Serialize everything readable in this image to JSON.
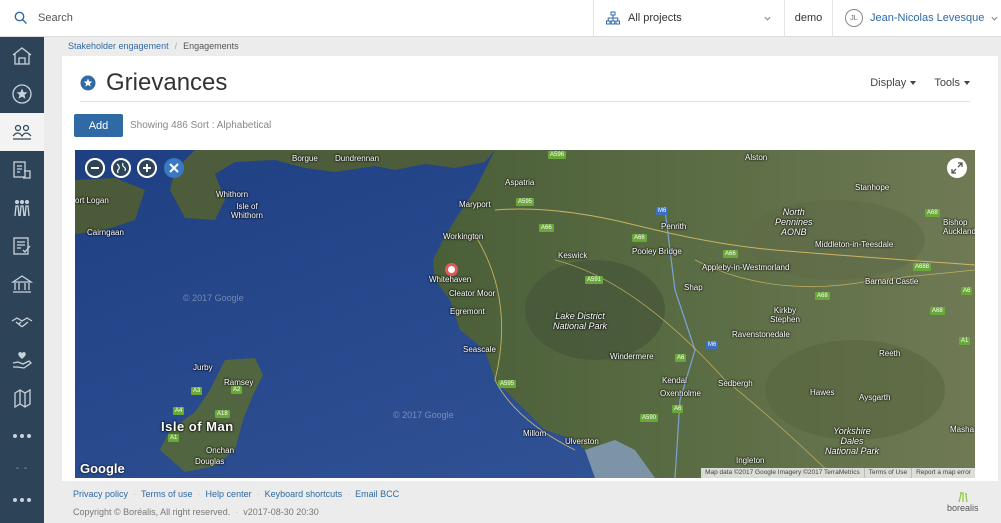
{
  "topbar": {
    "search_placeholder": "Search",
    "project_selector": "All projects",
    "workspace": "demo",
    "user_initials": "JL",
    "user_name": "Jean-Nicolas Levesque"
  },
  "sidebar": {
    "items": [
      {
        "icon": "home-icon"
      },
      {
        "icon": "star-icon"
      },
      {
        "icon": "stakeholders-icon",
        "active": true
      },
      {
        "icon": "documents-icon"
      },
      {
        "icon": "groups-icon"
      },
      {
        "icon": "checklist-icon"
      },
      {
        "icon": "institution-icon"
      },
      {
        "icon": "handshake-icon"
      },
      {
        "icon": "hand-heart-icon"
      },
      {
        "icon": "map-icon"
      },
      {
        "icon": "more-icon"
      }
    ],
    "bottom_more": "more-icon"
  },
  "breadcrumb": {
    "parent": "Stakeholder engagement",
    "current": "Engagements"
  },
  "page": {
    "title": "Grievances",
    "display_menu": "Display",
    "tools_menu": "Tools",
    "add_label": "Add",
    "showing_prefix": "Showing",
    "count": "486",
    "sort_label": "Sort :",
    "sort_value": "Alphabetical"
  },
  "map": {
    "places": [
      "Borgue",
      "Dundrennan",
      "Alston",
      "Stanhope",
      "Whithorn",
      "Isle of Whithorn",
      "ort Logan",
      "Cairngaan",
      "Aspatria",
      "Maryport",
      "Workington",
      "Penrith",
      "Keswick",
      "Pooley Bridge",
      "Whitehaven",
      "Cleator Moor",
      "Egremont",
      "Appleby-in-Westmorland",
      "Middleton-in-Teesdale",
      "Bishop Auckland",
      "Barnard Castle",
      "Shap",
      "Kirkby Stephen",
      "Ravenstonedale",
      "Seascale",
      "Windermere",
      "Kendal",
      "Oxenholme",
      "Sedbergh",
      "Reeth",
      "Hawes",
      "Aysgarth",
      "Jurby",
      "Ramsey",
      "Isle of Man",
      "Onchan",
      "Douglas",
      "Millom",
      "Ulverston",
      "Ingleton",
      "Masha"
    ],
    "parks": [
      {
        "line1": "North",
        "line2": "Pennines",
        "line3": "AONB"
      },
      {
        "line1": "Lake District",
        "line2": "National Park"
      },
      {
        "line1": "Yorkshire",
        "line2": "Dales",
        "line3": "National Park"
      }
    ],
    "roads": [
      "A596",
      "A595",
      "A66",
      "M6",
      "A591",
      "A66",
      "A66",
      "A68",
      "A688",
      "A68",
      "A6",
      "M6",
      "A595",
      "A590",
      "A6",
      "A3",
      "A18",
      "A2",
      "A4",
      "A1",
      "A68",
      "A1",
      "A6"
    ],
    "watermark": "© 2017 Google",
    "google_label": "Google",
    "attribution": [
      "Map data ©2017 Google Imagery ©2017 TerraMetrics",
      "Terms of Use",
      "Report a map error"
    ]
  },
  "footer": {
    "links": [
      "Privacy policy",
      "Terms of use",
      "Help center",
      "Keyboard shortcuts",
      "Email BCC"
    ],
    "copyright": "Copyright © Boréalis, All right reserved.",
    "version": "v2017-08-30 20:30",
    "logo_text": "borealis"
  },
  "colors": {
    "sidebar_bg": "#2d4458",
    "primary": "#2f6aa4",
    "marker": "#e05a5a"
  }
}
